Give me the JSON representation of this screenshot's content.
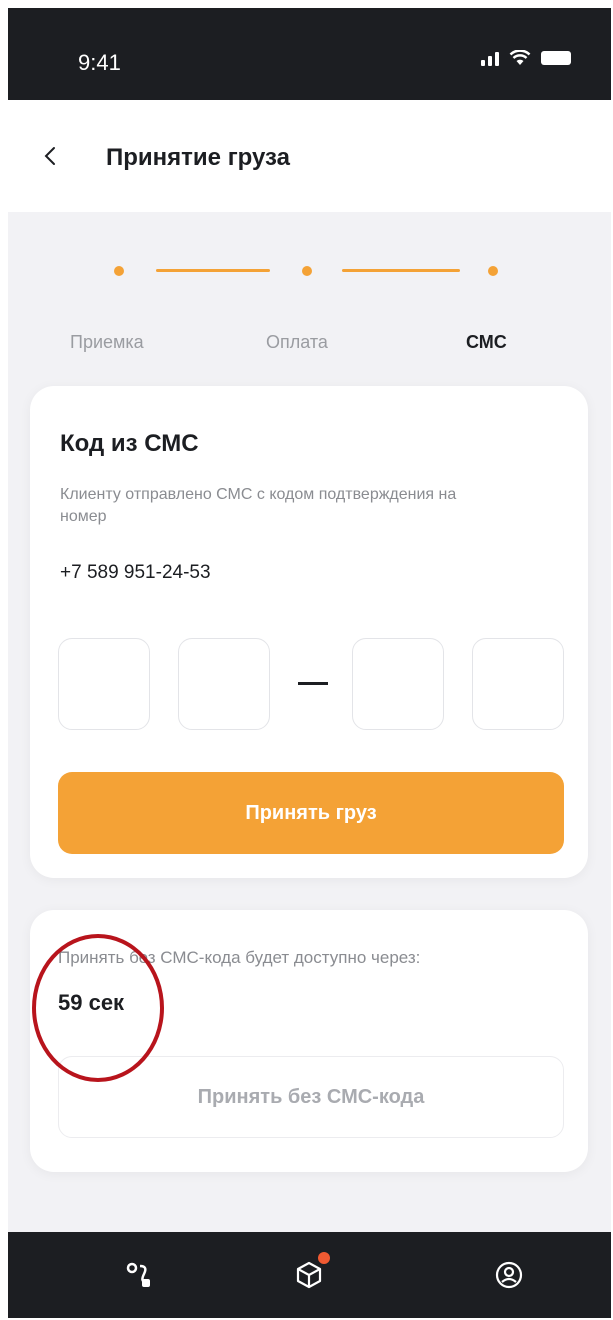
{
  "status_bar": {
    "time": "9:41"
  },
  "header": {
    "title": "Принятие груза"
  },
  "stepper": {
    "steps": [
      {
        "label": "Приемка",
        "active": false
      },
      {
        "label": "Оплата",
        "active": false
      },
      {
        "label": "СМС",
        "active": true
      }
    ]
  },
  "sms_card": {
    "title": "Код из СМС",
    "description": "Клиенту отправлено СМС с кодом подтверждения на номер",
    "phone": "+7 589 951-24-53",
    "code_digits": [
      "",
      "",
      "",
      ""
    ],
    "accept_button": "Принять груз"
  },
  "timer_card": {
    "text": "Принять без СМС-кода будет доступно через:",
    "value": "59 сек",
    "button": "Принять без СМС-кода"
  },
  "bottom_nav": {
    "items": [
      "route-icon",
      "package-icon",
      "profile-icon"
    ]
  },
  "colors": {
    "accent": "#f4a236",
    "dark": "#1c1e22",
    "badge": "#f05a32",
    "annotation": "#b8141c"
  }
}
